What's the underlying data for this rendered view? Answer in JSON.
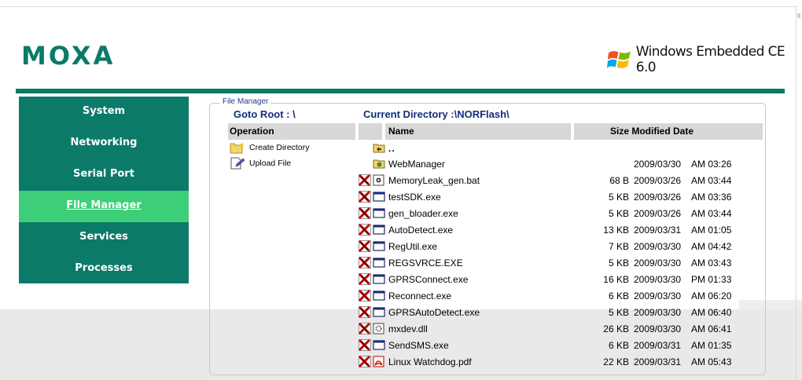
{
  "brand": {
    "logo_text": "MOXA",
    "os_text": "Windows Embedded CE 6.0"
  },
  "colors": {
    "brand_teal": "#0b7a68",
    "active_green": "#3ccf78",
    "link_navy": "#132e7c",
    "header_gray": "#d7d7d7"
  },
  "sidebar": {
    "items": [
      {
        "label": "System",
        "active": false
      },
      {
        "label": "Networking",
        "active": false
      },
      {
        "label": "Serial Port",
        "active": false
      },
      {
        "label": "File Manager",
        "active": true
      },
      {
        "label": "Services",
        "active": false
      },
      {
        "label": "Processes",
        "active": false
      }
    ]
  },
  "file_manager": {
    "legend": "File Manager",
    "goto_root": "Goto Root : \\",
    "current_directory": "Current Directory :\\NORFlash\\",
    "headers": {
      "operation": "Operation",
      "name": "Name",
      "size_modified": "Size Modified Date"
    },
    "operations": [
      {
        "label": "Create Directory",
        "icon": "new-folder-icon"
      },
      {
        "label": "Upload File",
        "icon": "upload-file-icon"
      }
    ],
    "up_dir": "..",
    "folders": [
      {
        "name": "WebManager",
        "date": "2009/03/30",
        "time": "AM 03:26"
      }
    ],
    "files": [
      {
        "name": "MemoryLeak_gen.bat",
        "size": "68 B",
        "date": "2009/03/26",
        "time": "AM 03:44",
        "icon": "batch-file-icon"
      },
      {
        "name": "testSDK.exe",
        "size": "5 KB",
        "date": "2009/03/26",
        "time": "AM 03:36",
        "icon": "exe-file-icon"
      },
      {
        "name": "gen_bloader.exe",
        "size": "5 KB",
        "date": "2009/03/26",
        "time": "AM 03:44",
        "icon": "exe-file-icon"
      },
      {
        "name": "AutoDetect.exe",
        "size": "13 KB",
        "date": "2009/03/31",
        "time": "AM 01:05",
        "icon": "exe-file-icon"
      },
      {
        "name": "RegUtil.exe",
        "size": "7 KB",
        "date": "2009/03/30",
        "time": "AM 04:42",
        "icon": "exe-file-icon"
      },
      {
        "name": "REGSVRCE.EXE",
        "size": "5 KB",
        "date": "2009/03/30",
        "time": "AM 03:43",
        "icon": "exe-file-icon"
      },
      {
        "name": "GPRSConnect.exe",
        "size": "16 KB",
        "date": "2009/03/30",
        "time": "PM 01:33",
        "icon": "exe-file-icon"
      },
      {
        "name": "Reconnect.exe",
        "size": "6 KB",
        "date": "2009/03/30",
        "time": "AM 06:20",
        "icon": "exe-file-icon"
      },
      {
        "name": "GPRSAutoDetect.exe",
        "size": "5 KB",
        "date": "2009/03/30",
        "time": "AM 06:40",
        "icon": "exe-file-icon"
      },
      {
        "name": "mxdev.dll",
        "size": "26 KB",
        "date": "2009/03/30",
        "time": "AM 06:41",
        "icon": "dll-file-icon"
      },
      {
        "name": "SendSMS.exe",
        "size": "6 KB",
        "date": "2009/03/31",
        "time": "AM 01:35",
        "icon": "exe-file-icon"
      },
      {
        "name": "Linux Watchdog.pdf",
        "size": "22 KB",
        "date": "2009/03/31",
        "time": "AM 05:43",
        "icon": "pdf-file-icon"
      }
    ]
  }
}
